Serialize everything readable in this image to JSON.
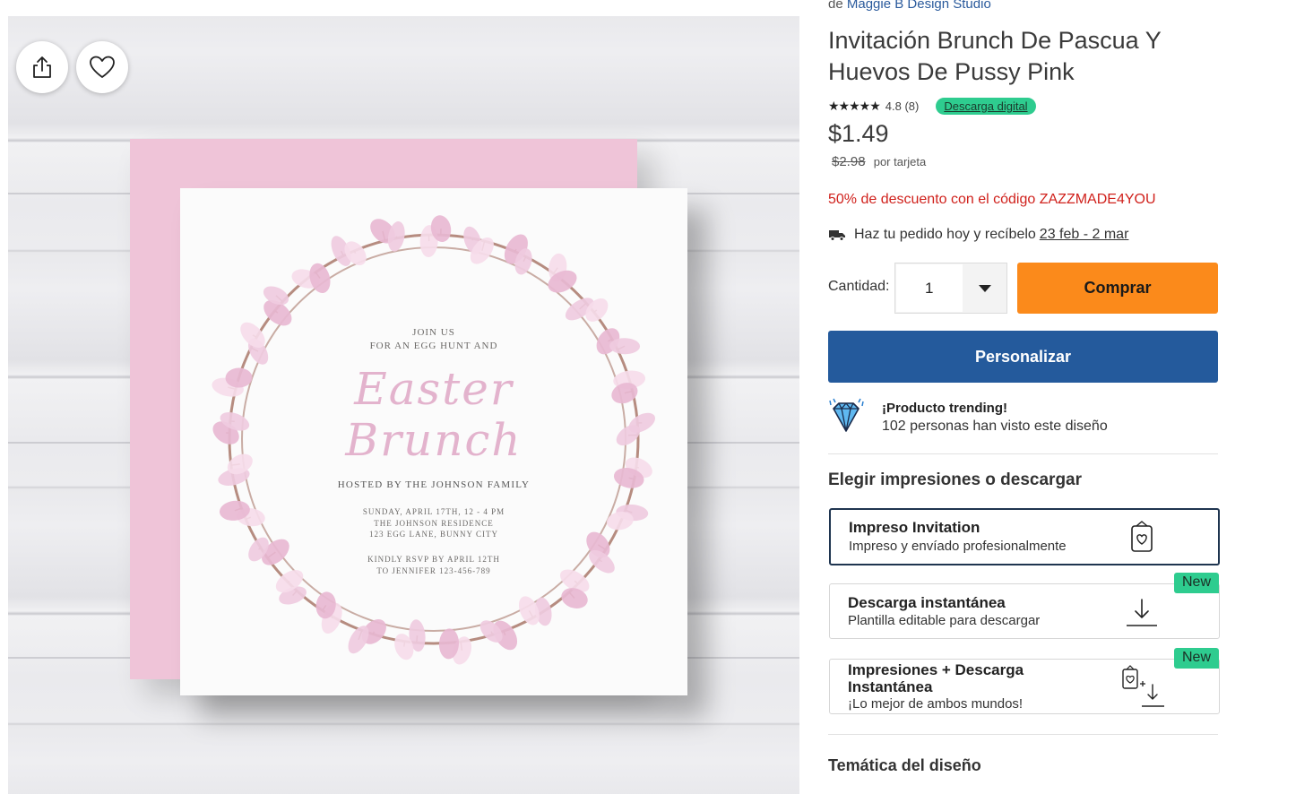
{
  "image": {
    "share_label": "share",
    "card": {
      "line1": "JOIN US",
      "line2": "FOR AN EGG HUNT AND",
      "script1": "Easter",
      "script2": "Brunch",
      "hosted": "HOSTED BY THE JOHNSON FAMILY",
      "details1": "SUNDAY, APRIL 17TH, 12 - 4 PM",
      "details2": "THE JOHNSON RESIDENCE",
      "details3": "123 EGG LANE, BUNNY CITY",
      "rsvp1": "KINDLY RSVP BY APRIL 12TH",
      "rsvp2": "TO JENNIFER 123-456-789"
    }
  },
  "product": {
    "designer_prefix": "de",
    "designer_name": "Maggie B Design Studio",
    "title": "Invitación Brunch De Pascua Y Huevos De Pussy Pink",
    "stars": "★★★★★",
    "rating": "4.8 (8)",
    "digital_badge": "Descarga digital",
    "price": "$1.49",
    "old_price": "$2.98",
    "per_unit": "por tarjeta",
    "promo": "50% de descuento con el código ZAZZMADE4YOU",
    "delivery_text": "Haz tu pedido hoy y recíbelo",
    "delivery_dates": "23 feb - 2 mar"
  },
  "purchase": {
    "quantity_label": "Cantidad:",
    "quantity_value": "1",
    "buy_label": "Comprar",
    "customize_label": "Personalizar"
  },
  "trending": {
    "title": "¡Producto trending!",
    "subtitle": "102 personas han visto este diseño"
  },
  "options": {
    "section_title": "Elegir impresiones o descargar",
    "items": [
      {
        "title": "Impreso Invitation",
        "subtitle": "Impreso y envíado profesionalmente",
        "badge": ""
      },
      {
        "title": "Descarga instantánea",
        "subtitle": "Plantilla editable para descargar",
        "badge": "New"
      },
      {
        "title": "Impresiones + Descarga Instantánea",
        "subtitle": "¡Lo mejor de ambos mundos!",
        "badge": "New"
      }
    ]
  },
  "theme": {
    "title": "Temática del diseño"
  },
  "colors": {
    "buy": "#fb8a1b",
    "customize": "#245a9c",
    "promo": "#d0211c",
    "badge": "#2ecc8f",
    "envelope": "#efc4d8"
  },
  "icons": {
    "share": "share-icon",
    "favorite": "heart-icon",
    "truck": "truck-icon",
    "diamond": "diamond-icon",
    "print": "print-card-icon",
    "download": "download-icon",
    "combo": "print-plus-download-icon",
    "dropdown": "chevron-down-icon"
  }
}
